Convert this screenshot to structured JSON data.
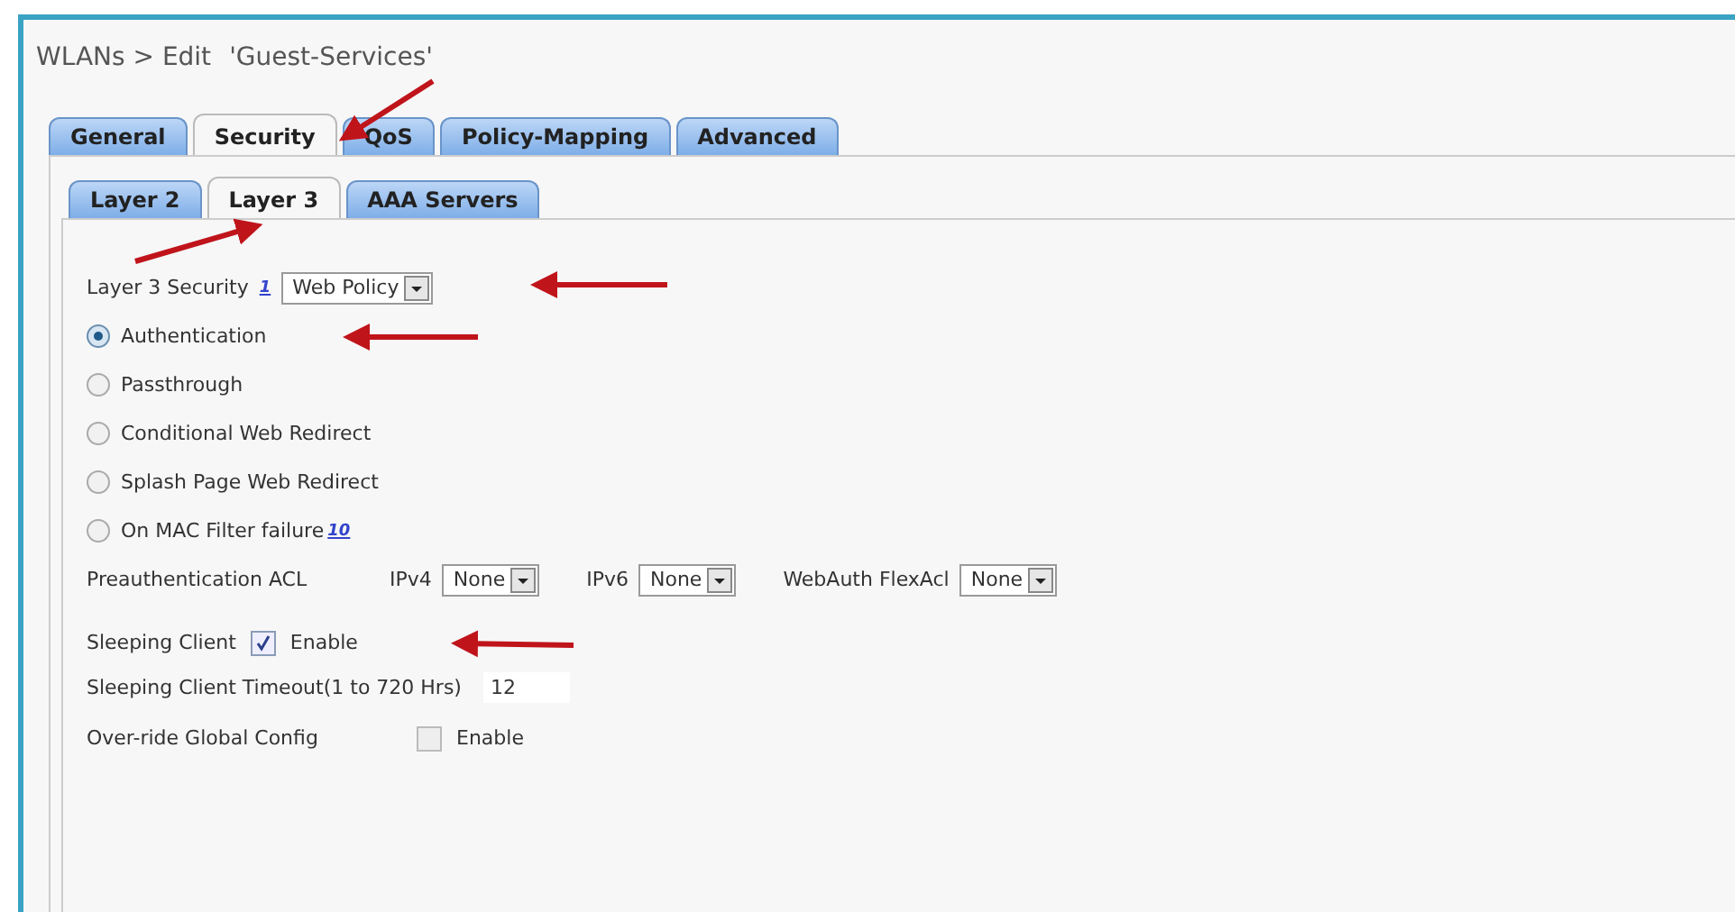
{
  "breadcrumb": "WLANs > Edit",
  "wlan_name": "'Guest-Services'",
  "tabs": [
    {
      "label": "General",
      "selected": false
    },
    {
      "label": "Security",
      "selected": true
    },
    {
      "label": "QoS",
      "selected": false
    },
    {
      "label": "Policy-Mapping",
      "selected": false
    },
    {
      "label": "Advanced",
      "selected": false
    }
  ],
  "subtabs": [
    {
      "label": "Layer 2",
      "selected": false
    },
    {
      "label": "Layer 3",
      "selected": true
    },
    {
      "label": "AAA Servers",
      "selected": false
    }
  ],
  "layer3_security": {
    "label": "Layer 3 Security",
    "footnote": "1",
    "value": "Web Policy"
  },
  "policy_options": [
    {
      "label": "Authentication",
      "selected": true
    },
    {
      "label": "Passthrough",
      "selected": false
    },
    {
      "label": "Conditional Web Redirect",
      "selected": false
    },
    {
      "label": "Splash Page Web Redirect",
      "selected": false
    },
    {
      "label": "On MAC Filter failure",
      "footnote": "10",
      "selected": false
    }
  ],
  "preauth_acl": {
    "label": "Preauthentication ACL",
    "fields": [
      {
        "label": "IPv4",
        "value": "None"
      },
      {
        "label": "IPv6",
        "value": "None"
      },
      {
        "label": "WebAuth FlexAcl",
        "value": "None"
      }
    ]
  },
  "sleeping_client": {
    "label": "Sleeping Client",
    "checked": true,
    "option": "Enable"
  },
  "timeout": {
    "label": "Sleeping Client Timeout(1 to 720 Hrs)",
    "value": "12"
  },
  "override": {
    "label": "Over-ride Global Config",
    "checked": false,
    "option": "Enable"
  }
}
